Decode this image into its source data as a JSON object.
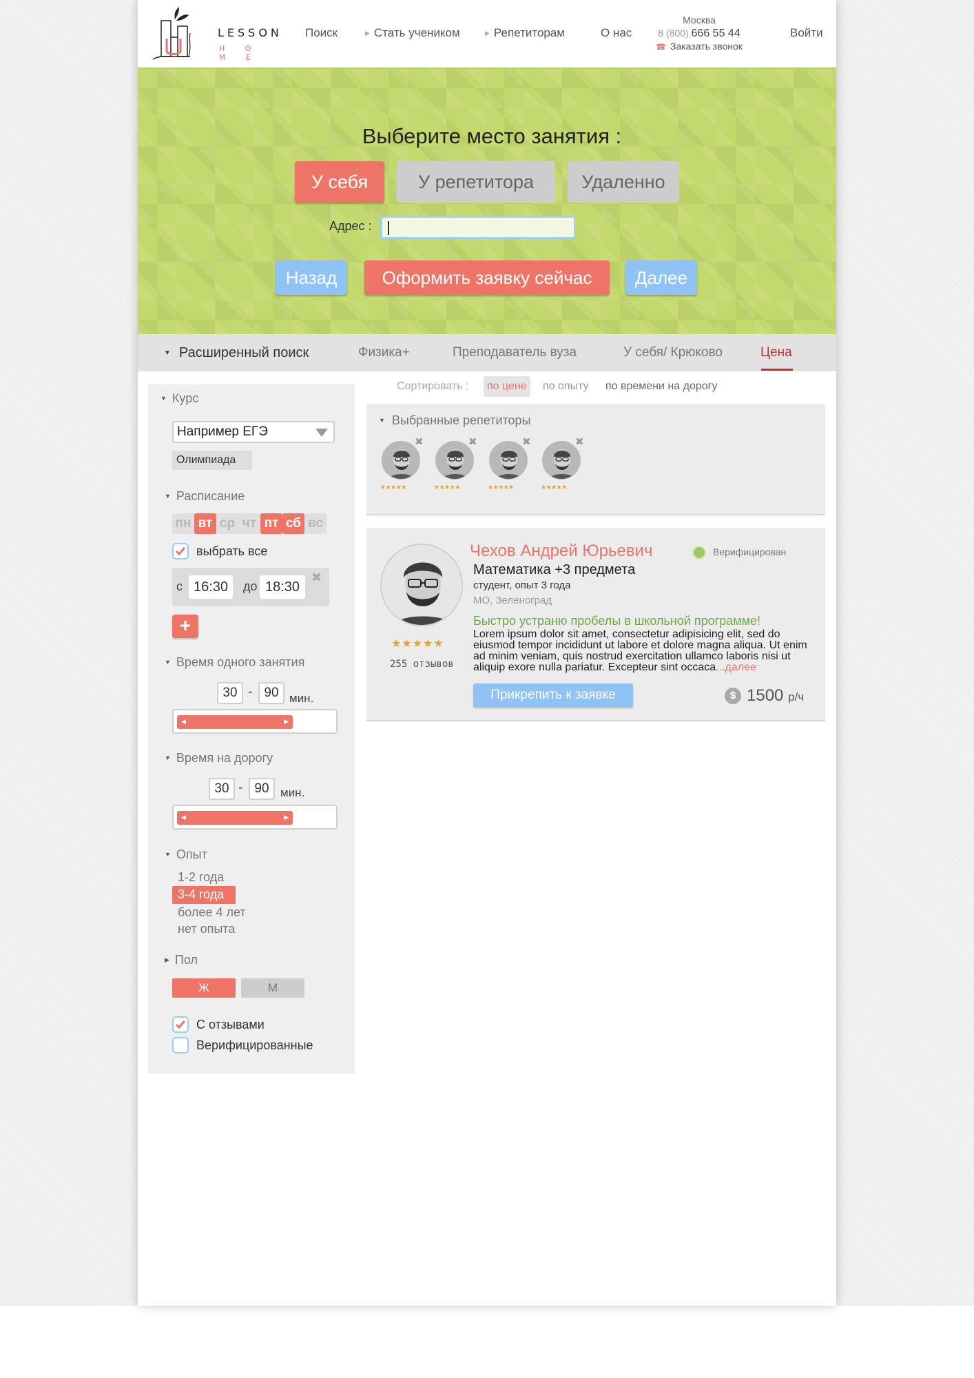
{
  "header": {
    "logo_word": "LESSON",
    "logo_sub": "H O M E",
    "nav": [
      {
        "label": "Поиск",
        "arrow": false
      },
      {
        "label": "Стать учеником",
        "arrow": true
      },
      {
        "label": "Репетиторам",
        "arrow": true
      },
      {
        "label": "О нас",
        "arrow": false
      }
    ],
    "contact": {
      "city": "Москва",
      "phone_code": "8 (800)",
      "phone_number": "666 55 44",
      "callback": "Заказать звонок"
    },
    "login": "Войти"
  },
  "hero": {
    "title": "Выберите место занятия :",
    "place_options": [
      "У себя",
      "У репетитора",
      "Удаленно"
    ],
    "selected_place": "У себя",
    "address_label": "Адрес :",
    "address_value": "",
    "back": "Назад",
    "submit": "Оформить заявку сейчас",
    "next": "Далее"
  },
  "tabs": {
    "advanced": "Расширенный поиск",
    "items": [
      "Физика+",
      "Преподаватель вуза",
      "У себя/ Крюково",
      "Цена"
    ],
    "active": "Цена"
  },
  "filters": {
    "course": {
      "title": "Курс",
      "select_value": "Например ЕГЭ",
      "chip": "Олимпиада"
    },
    "schedule": {
      "title": "Расписание",
      "days": [
        {
          "label": "пн",
          "on": false
        },
        {
          "label": "вт",
          "on": true
        },
        {
          "label": "ср",
          "on": false
        },
        {
          "label": "чт",
          "on": false
        },
        {
          "label": "пт",
          "on": true
        },
        {
          "label": "сб",
          "on": true
        },
        {
          "label": "вс",
          "on": false
        }
      ],
      "select_all": "выбрать все",
      "select_all_checked": true,
      "from_label": "с",
      "from": "16:30",
      "to_label": "до",
      "to": "18:30",
      "add": "+"
    },
    "lesson_time": {
      "title": "Время одного занятия",
      "min": "30",
      "max": "90",
      "dash": "-",
      "unit": "мин."
    },
    "travel_time": {
      "title": "Время на дорогу",
      "min": "30",
      "max": "90",
      "dash": "-",
      "unit": "мин."
    },
    "experience": {
      "title": "Опыт",
      "options": [
        "1-2 года",
        "3-4 года",
        "более 4 лет",
        "нет опыта"
      ],
      "selected": "3-4 года"
    },
    "gender": {
      "title": "Пол",
      "female": "Ж",
      "male": "М",
      "selected": "Ж"
    },
    "with_reviews": {
      "label": "С отзывами",
      "checked": true
    },
    "verified_only": {
      "label": "Верифицированные",
      "checked": false
    }
  },
  "sort": {
    "label": "Сортировать :",
    "options": [
      "по цене",
      "по опыту",
      "по времени на дорогу"
    ],
    "active": "по цене"
  },
  "selected_tutors": {
    "title": "Выбранные репетиторы",
    "items": [
      {
        "rating": 5,
        "stars": "★★★★★"
      },
      {
        "rating": 5,
        "stars": "★★★★★"
      },
      {
        "rating": 5,
        "stars": "★★★★★"
      },
      {
        "rating": 5,
        "stars": "★★★★★"
      }
    ]
  },
  "tutor": {
    "name": "Чехов Андрей Юрьевич",
    "verified": "Верифицирован",
    "subjects": "Математика +3 предмета",
    "info": "студент, опыт 3 года",
    "location": "МО, Зеленоград",
    "pitch": "Быстро устраню пробелы в школьной программе!",
    "description": "Lorem ipsum dolor sit amet, consectetur adipisicing elit, sed do eiusmod tempor incididunt ut labore et dolore magna aliqua. Ut enim ad minim veniam, quis nostrud exercitation ullamco laboris nisi ut aliquip exore nulla pariatur. Excepteur sint occaca",
    "more": "...далее",
    "stars": "★★★★★",
    "rating": 5,
    "reviews": "255 отзывов",
    "attach": "Прикрепить к заявке",
    "currency_icon": "$",
    "price": "1500",
    "price_unit": "р/ч"
  },
  "colors": {
    "accent_red": "#ef7468",
    "accent_blue": "#8fc3f5",
    "hero_green": "#c3d86d",
    "pitch_green": "#6aa94a",
    "active_tab": "#c0302a"
  }
}
